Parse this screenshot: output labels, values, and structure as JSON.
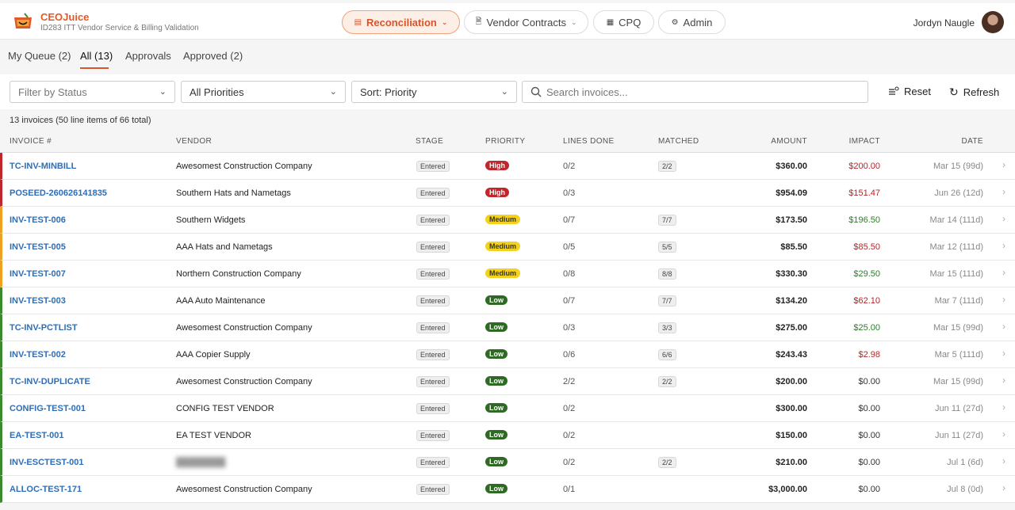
{
  "app": {
    "brand": "CEOJuice",
    "subtitle": "ID283 ITT Vendor Service & Billing Validation",
    "user_name": "Jordyn Naugle"
  },
  "nav": [
    {
      "label": "Reconciliation",
      "icon": "inbox-icon",
      "active": true,
      "dropdown": true
    },
    {
      "label": "Vendor Contracts",
      "icon": "document-icon",
      "active": false,
      "dropdown": true
    },
    {
      "label": "CPQ",
      "icon": "calculator-icon",
      "active": false,
      "dropdown": false
    },
    {
      "label": "Admin",
      "icon": "gear-icon",
      "active": false,
      "dropdown": false
    }
  ],
  "tabs": [
    {
      "label": "My Queue (2)",
      "active": false
    },
    {
      "label": "All (13)",
      "active": true
    },
    {
      "label": "Approvals",
      "active": false
    },
    {
      "label": "Approved (2)",
      "active": false
    }
  ],
  "filters": {
    "status_placeholder": "Filter by Status",
    "priority": "All Priorities",
    "sort": "Sort: Priority",
    "search_placeholder": "Search invoices...",
    "reset_label": "Reset",
    "refresh_label": "Refresh"
  },
  "summary": "13 invoices (50 line items of 66 total)",
  "columns": {
    "invoice": "INVOICE #",
    "vendor": "VENDOR",
    "stage": "STAGE",
    "priority": "PRIORITY",
    "lines_done": "LINES DONE",
    "matched": "MATCHED",
    "amount": "AMOUNT",
    "impact": "IMPACT",
    "date": "DATE"
  },
  "rows": [
    {
      "invoice": "TC-INV-MINBILL",
      "vendor": "Awesomest Construction Company",
      "stage": "Entered",
      "priority": "High",
      "lines_done": "0/2",
      "matched": "2/2",
      "amount": "$360.00",
      "impact": "$200.00",
      "impact_type": "neg",
      "date": "Mar 15 (99d)"
    },
    {
      "invoice": "POSEED-260626141835",
      "vendor": "Southern Hats and Nametags",
      "stage": "Entered",
      "priority": "High",
      "lines_done": "0/3",
      "matched": "",
      "amount": "$954.09",
      "impact": "$151.47",
      "impact_type": "neg",
      "date": "Jun 26 (12d)"
    },
    {
      "invoice": "INV-TEST-006",
      "vendor": "Southern Widgets",
      "stage": "Entered",
      "priority": "Medium",
      "lines_done": "0/7",
      "matched": "7/7",
      "amount": "$173.50",
      "impact": "$196.50",
      "impact_type": "pos",
      "date": "Mar 14 (111d)"
    },
    {
      "invoice": "INV-TEST-005",
      "vendor": "AAA Hats and Nametags",
      "stage": "Entered",
      "priority": "Medium",
      "lines_done": "0/5",
      "matched": "5/5",
      "amount": "$85.50",
      "impact": "$85.50",
      "impact_type": "neg",
      "date": "Mar 12 (111d)"
    },
    {
      "invoice": "INV-TEST-007",
      "vendor": "Northern Construction Company",
      "stage": "Entered",
      "priority": "Medium",
      "lines_done": "0/8",
      "matched": "8/8",
      "amount": "$330.30",
      "impact": "$29.50",
      "impact_type": "pos",
      "date": "Mar 15 (111d)"
    },
    {
      "invoice": "INV-TEST-003",
      "vendor": "AAA Auto Maintenance",
      "stage": "Entered",
      "priority": "Low",
      "lines_done": "0/7",
      "matched": "7/7",
      "amount": "$134.20",
      "impact": "$62.10",
      "impact_type": "neg",
      "date": "Mar 7 (111d)"
    },
    {
      "invoice": "TC-INV-PCTLIST",
      "vendor": "Awesomest Construction Company",
      "stage": "Entered",
      "priority": "Low",
      "lines_done": "0/3",
      "matched": "3/3",
      "amount": "$275.00",
      "impact": "$25.00",
      "impact_type": "pos",
      "date": "Mar 15 (99d)"
    },
    {
      "invoice": "INV-TEST-002",
      "vendor": "AAA Copier Supply",
      "stage": "Entered",
      "priority": "Low",
      "lines_done": "0/6",
      "matched": "6/6",
      "amount": "$243.43",
      "impact": "$2.98",
      "impact_type": "neg",
      "date": "Mar 5 (111d)"
    },
    {
      "invoice": "TC-INV-DUPLICATE",
      "vendor": "Awesomest Construction Company",
      "stage": "Entered",
      "priority": "Low",
      "lines_done": "2/2",
      "matched": "2/2",
      "amount": "$200.00",
      "impact": "$0.00",
      "impact_type": "zero",
      "date": "Mar 15 (99d)"
    },
    {
      "invoice": "CONFIG-TEST-001",
      "vendor": "CONFIG TEST VENDOR",
      "stage": "Entered",
      "priority": "Low",
      "lines_done": "0/2",
      "matched": "",
      "amount": "$300.00",
      "impact": "$0.00",
      "impact_type": "zero",
      "date": "Jun 11 (27d)"
    },
    {
      "invoice": "EA-TEST-001",
      "vendor": "EA TEST VENDOR",
      "stage": "Entered",
      "priority": "Low",
      "lines_done": "0/2",
      "matched": "",
      "amount": "$150.00",
      "impact": "$0.00",
      "impact_type": "zero",
      "date": "Jun 11 (27d)"
    },
    {
      "invoice": "INV-ESCTEST-001",
      "vendor": "",
      "vendor_blurred": true,
      "stage": "Entered",
      "priority": "Low",
      "lines_done": "0/2",
      "matched": "2/2",
      "amount": "$210.00",
      "impact": "$0.00",
      "impact_type": "zero",
      "date": "Jul 1 (6d)"
    },
    {
      "invoice": "ALLOC-TEST-171",
      "vendor": "Awesomest Construction Company",
      "stage": "Entered",
      "priority": "Low",
      "lines_done": "0/1",
      "matched": "",
      "amount": "$3,000.00",
      "impact": "$0.00",
      "impact_type": "zero",
      "date": "Jul 8 (0d)"
    }
  ]
}
